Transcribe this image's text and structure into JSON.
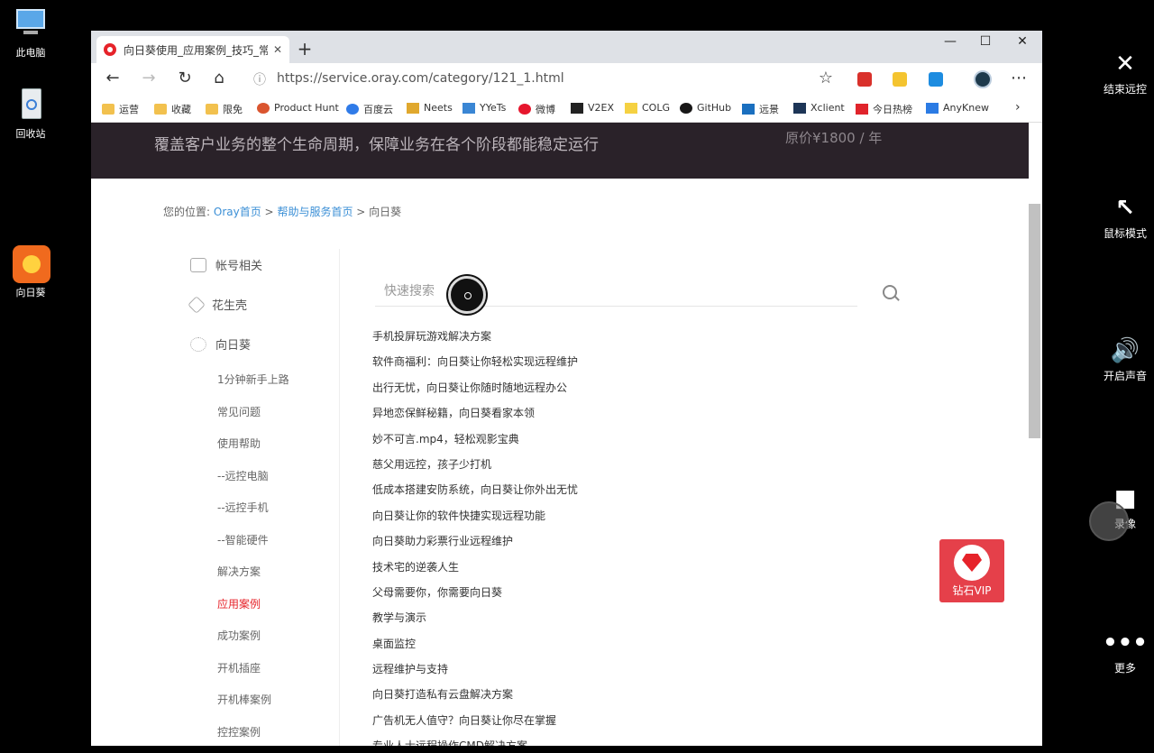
{
  "desktop": {
    "icons": [
      {
        "label": "此电脑"
      },
      {
        "label": "回收站"
      },
      {
        "label": "向日葵"
      }
    ]
  },
  "remote_toolbar": {
    "end_remote": "结束远控",
    "mouse_mode": "鼠标模式",
    "sound_on": "开启声音",
    "record": "录像",
    "more": "更多"
  },
  "browser": {
    "tab_title": "向日葵使用_应用案例_技巧_常见",
    "url": "https://service.oray.com/category/121_1.html",
    "bookmarks": [
      "运营",
      "收藏",
      "限免",
      "Product Hunt",
      "百度云",
      "Neets",
      "YYeTs",
      "微博",
      "V2EX",
      "COLG",
      "GitHub",
      "远景",
      "Xclient",
      "今日热榜",
      "AnyKnew"
    ]
  },
  "page": {
    "banner_text": "覆盖客户业务的整个生命周期，保障业务在各个阶段都能稳定运行",
    "banner_price": "原价¥1800 / 年",
    "breadcrumb": {
      "prefix": "您的位置:",
      "home": "Oray首页",
      "sep1": ">",
      "help": "帮助与服务首页",
      "sep2": ">",
      "current": "向日葵"
    },
    "sidebar": {
      "account": "帐号相关",
      "peanut": "花生壳",
      "sunflower": "向日葵",
      "sub_items": [
        "1分钟新手上路",
        "常见问题",
        "使用帮助",
        "--远控电脑",
        "--远控手机",
        "--智能硬件",
        "解决方案",
        "应用案例",
        "成功案例",
        "开机插座",
        "开机棒案例",
        "控控案例"
      ]
    },
    "search_placeholder": "快速搜索",
    "articles": [
      "手机投屏玩游戏解决方案",
      "软件商福利：向日葵让你轻松实现远程维护",
      "出行无忧，向日葵让你随时随地远程办公",
      "异地恋保鲜秘籍，向日葵看家本领",
      "妙不可言.mp4，轻松观影宝典",
      "慈父用远控，孩子少打机",
      "低成本搭建安防系统，向日葵让你外出无忧",
      "向日葵让你的软件快捷实现远程功能",
      "向日葵助力彩票行业远程维护",
      "技术宅的逆袭人生",
      "父母需要你，你需要向日葵",
      "教学与演示",
      "桌面监控",
      "远程维护与支持",
      "向日葵打造私有云盘解决方案",
      "广告机无人值守？向日葵让你尽在掌握",
      "专业人士远程操作CMD解决方案"
    ],
    "vip_label": "钻石VIP"
  }
}
